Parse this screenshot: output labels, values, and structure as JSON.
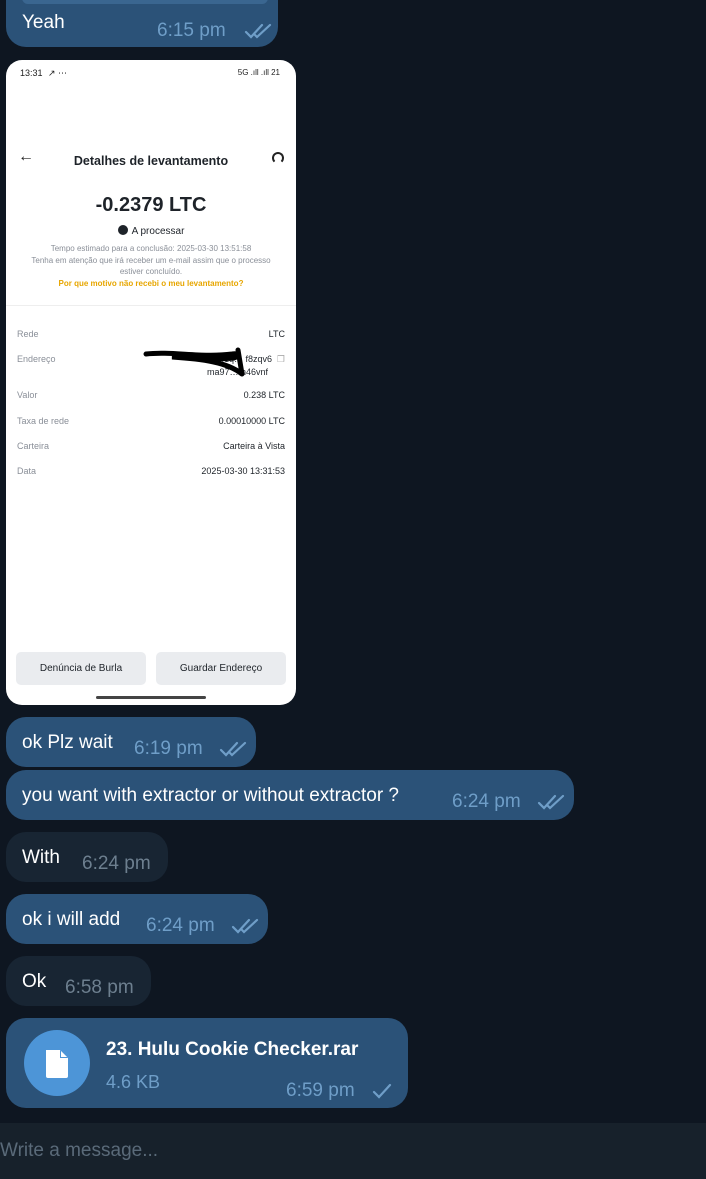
{
  "messages": {
    "m1": {
      "text": "Yeah",
      "time": "6:15 pm"
    },
    "m2": {
      "text": "ok Plz wait",
      "time": "6:19 pm"
    },
    "m3": {
      "text": "you want with extractor or without extractor ?",
      "time": "6:24 pm"
    },
    "m4": {
      "text": "With",
      "time": "6:24 pm"
    },
    "m5": {
      "text": "ok i will add",
      "time": "6:24 pm"
    },
    "m6": {
      "text": "Ok",
      "time": "6:58 pm"
    }
  },
  "screenshot": {
    "status_time": "13:31",
    "status_icons": "↗ ⋯",
    "status_right": "5G .ıll .ıll 21",
    "title": "Detalhes de levantamento",
    "amount": "-0.2379 LTC",
    "status": "A processar",
    "note_line1": "Tempo estimado para a conclusão: 2025-03-30 13:51:58",
    "note_line2": "Tenha em atenção que irá receber um e-mail assim que o processo",
    "note_line3": "estiver concluído.",
    "link": "Por que motivo não recebi o meu levantamento?",
    "rows": [
      {
        "label": "Rede",
        "value": "LTC"
      },
      {
        "label": "Endereço",
        "value": "ltc1q… f8zqv6",
        "value2": "ma97… n46vnf"
      },
      {
        "label": "Valor",
        "value": "0.238 LTC"
      },
      {
        "label": "Taxa de rede",
        "value": "0.00010000 LTC"
      },
      {
        "label": "Carteira",
        "value": "Carteira à Vista"
      },
      {
        "label": "Data",
        "value": "2025-03-30 13:31:53"
      }
    ],
    "btn_report": "Denúncia de Burla",
    "btn_save": "Guardar Endereço"
  },
  "file": {
    "name": "23. Hulu Cookie Checker.rar",
    "size": "4.6 KB",
    "time": "6:59 pm",
    "icon": "file-icon"
  },
  "composer": {
    "placeholder": "Write a message..."
  },
  "colors": {
    "background": "#0e1621",
    "outgoing": "#2b5278",
    "incoming": "#182533",
    "accent": "#4d95d7",
    "link": "#e7a600"
  }
}
